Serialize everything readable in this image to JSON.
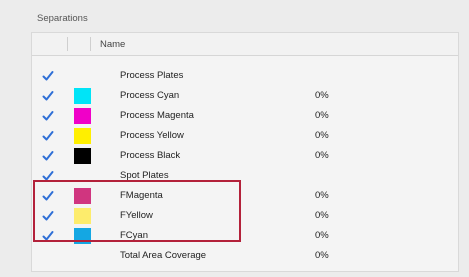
{
  "section": {
    "title": "Separations"
  },
  "table": {
    "column_name": "Name",
    "rows": [
      {
        "label": "Process Plates",
        "checked": true,
        "swatch": null,
        "pct": ""
      },
      {
        "label": "Process Cyan",
        "checked": true,
        "swatch": "#00e4f7",
        "pct": "0%"
      },
      {
        "label": "Process Magenta",
        "checked": true,
        "swatch": "#f000c8",
        "pct": "0%"
      },
      {
        "label": "Process Yellow",
        "checked": true,
        "swatch": "#ffef00",
        "pct": "0%"
      },
      {
        "label": "Process Black",
        "checked": true,
        "swatch": "#000000",
        "pct": "0%"
      },
      {
        "label": "Spot Plates",
        "checked": true,
        "swatch": null,
        "pct": ""
      },
      {
        "label": "FMagenta",
        "checked": true,
        "swatch": "#d0357f",
        "pct": "0%"
      },
      {
        "label": "FYellow",
        "checked": true,
        "swatch": "#fdec6c",
        "pct": "0%"
      },
      {
        "label": "FCyan",
        "checked": true,
        "swatch": "#14a7e3",
        "pct": "0%"
      },
      {
        "label": "Total Area Coverage",
        "checked": false,
        "swatch": null,
        "pct": "0%"
      }
    ]
  },
  "colors": {
    "check": "#2f6fd6",
    "highlight": "#b3213a"
  }
}
